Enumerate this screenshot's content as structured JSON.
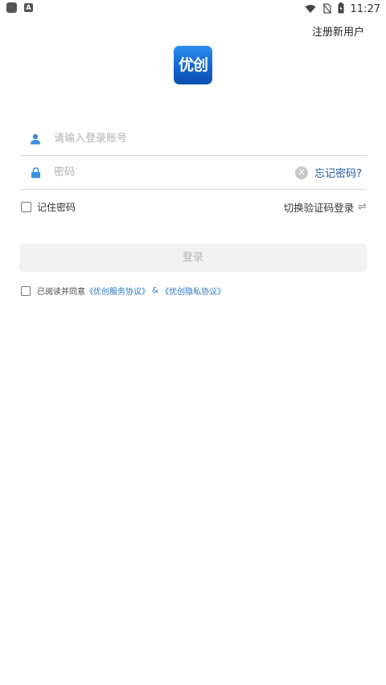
{
  "status_bar": {
    "time": "11:27",
    "left_icons": [
      "app-icon",
      "notification-a-icon"
    ],
    "right_icons": [
      "wifi-icon",
      "no-sim-icon",
      "battery-icon"
    ],
    "a_glyph": "A"
  },
  "header": {
    "register_label": "注册新用户"
  },
  "logo": {
    "text": "优创",
    "color": "#1a6fd8"
  },
  "account_field": {
    "placeholder": "请输入登录账号",
    "value": "",
    "icon": "user-icon"
  },
  "password_field": {
    "placeholder": "密码",
    "value": "",
    "icon": "lock-icon",
    "clear_glyph": "✕",
    "forgot_label": "忘记密码?"
  },
  "options": {
    "remember_label": "记住密码",
    "remember_checked": false,
    "switch_label": "切换验证码登录",
    "switch_glyph": "⇌"
  },
  "login_button": {
    "label": "登录"
  },
  "agreement": {
    "prefix": "已阅读并同意",
    "service_link": "《优创服务协议》",
    "connector": " & ",
    "privacy_link": "《优创隐私协议》",
    "checked": false
  },
  "colors": {
    "accent": "#2a74c0",
    "icon_blue": "#3a8fe0",
    "button_bg": "#f2f2f2"
  }
}
